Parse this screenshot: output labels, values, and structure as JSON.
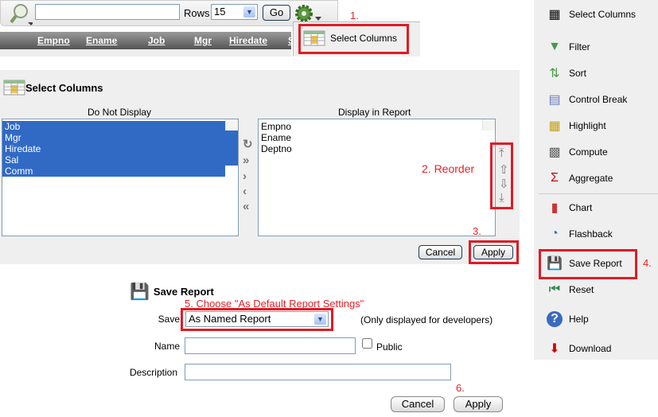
{
  "toolbar": {
    "search_value": "",
    "rows_label": "Rows",
    "rows_value": "15",
    "go_label": "Go"
  },
  "report_columns": [
    "Empno",
    "Ename",
    "Job",
    "Mgr",
    "Hiredate",
    "S"
  ],
  "actions_dropdown": {
    "item": "Select Columns"
  },
  "annotations": {
    "a1": "1.",
    "a2": "2. Reorder",
    "a3": "3.",
    "a4": "4.",
    "a5": "5. Choose \"As Default Report Settings\"",
    "a6": "6."
  },
  "select_columns": {
    "title": "Select Columns",
    "left_label": "Do Not Display",
    "left_items": [
      "Job",
      "Mgr",
      "Hiredate",
      "Sal",
      "Comm"
    ],
    "right_label": "Display in Report",
    "right_items": [
      "Empno",
      "Ename",
      "Deptno"
    ],
    "cancel": "Cancel",
    "apply": "Apply"
  },
  "menu": {
    "items": [
      "Select Columns",
      "Filter",
      "Sort",
      "Control Break",
      "Highlight",
      "Compute",
      "Aggregate",
      "Chart",
      "Flashback",
      "Save Report",
      "Reset",
      "Help",
      "Download"
    ]
  },
  "save_report": {
    "title": "Save Report",
    "save_label": "Save",
    "save_value": "As Named Report",
    "save_note": "(Only displayed for developers)",
    "name_label": "Name",
    "name_value": "",
    "public_label": "Public",
    "public_checked": false,
    "description_label": "Description",
    "description_value": "",
    "cancel": "Cancel",
    "apply": "Apply"
  }
}
